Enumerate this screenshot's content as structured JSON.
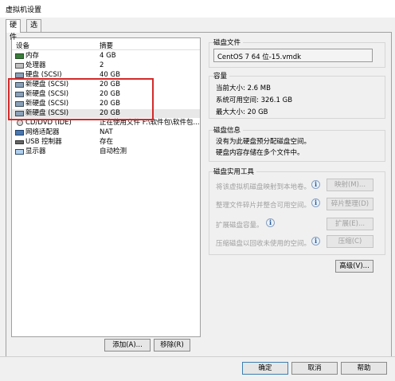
{
  "window": {
    "title": "虚拟机设置"
  },
  "tabs": [
    "硬件",
    "选项"
  ],
  "device_list": {
    "headers": {
      "device": "设备",
      "summary": "摘要"
    },
    "rows": [
      {
        "name": "内存",
        "summary": "4 GB",
        "icon": "memory-icon"
      },
      {
        "name": "处理器",
        "summary": "2",
        "icon": "cpu-icon"
      },
      {
        "name": "硬盘 (SCSI)",
        "summary": "40 GB",
        "icon": "hard-disk-icon"
      },
      {
        "name": "新硬盘 (SCSI)",
        "summary": "20 GB",
        "icon": "hard-disk-icon"
      },
      {
        "name": "新硬盘 (SCSI)",
        "summary": "20 GB",
        "icon": "hard-disk-icon"
      },
      {
        "name": "新硬盘 (SCSI)",
        "summary": "20 GB",
        "icon": "hard-disk-icon"
      },
      {
        "name": "新硬盘 (SCSI)",
        "summary": "20 GB",
        "icon": "hard-disk-icon"
      },
      {
        "name": "CD/DVD (IDE)",
        "summary": "正在使用文件 F:\\软件包\\软件包...",
        "icon": "cd-dvd-icon"
      },
      {
        "name": "网络适配器",
        "summary": "NAT",
        "icon": "network-adapter-icon"
      },
      {
        "name": "USB 控制器",
        "summary": "存在",
        "icon": "usb-controller-icon"
      },
      {
        "name": "显示器",
        "summary": "自动检测",
        "icon": "display-icon"
      }
    ]
  },
  "list_buttons": {
    "add": "添加(A)...",
    "remove": "移除(R)"
  },
  "disk_file": {
    "label": "磁盘文件",
    "value": "CentOS 7 64 位-15.vmdk"
  },
  "capacity": {
    "label": "容量",
    "current": "当前大小: 2.6 MB",
    "available": "系统可用空间: 326.1 GB",
    "max": "最大大小: 20 GB"
  },
  "disk_info": {
    "label": "磁盘信息",
    "line1": "没有为此硬盘预分配磁盘空间。",
    "line2": "硬盘内容存储在多个文件中。"
  },
  "disk_utilities": {
    "label": "磁盘实用工具",
    "items": [
      {
        "text": "将该虚拟机磁盘映射到本地卷。",
        "button": "映射(M)..."
      },
      {
        "text": "整理文件碎片并整合可用空间。",
        "button": "碎片整理(D)"
      },
      {
        "text": "扩展磁盘容量。",
        "button": "扩展(E)..."
      },
      {
        "text": "压缩磁盘以回收未使用的空间。",
        "button": "压缩(C)"
      }
    ]
  },
  "advanced_button": "高级(V)...",
  "footer": {
    "ok": "确定",
    "cancel": "取消",
    "help": "帮助"
  }
}
